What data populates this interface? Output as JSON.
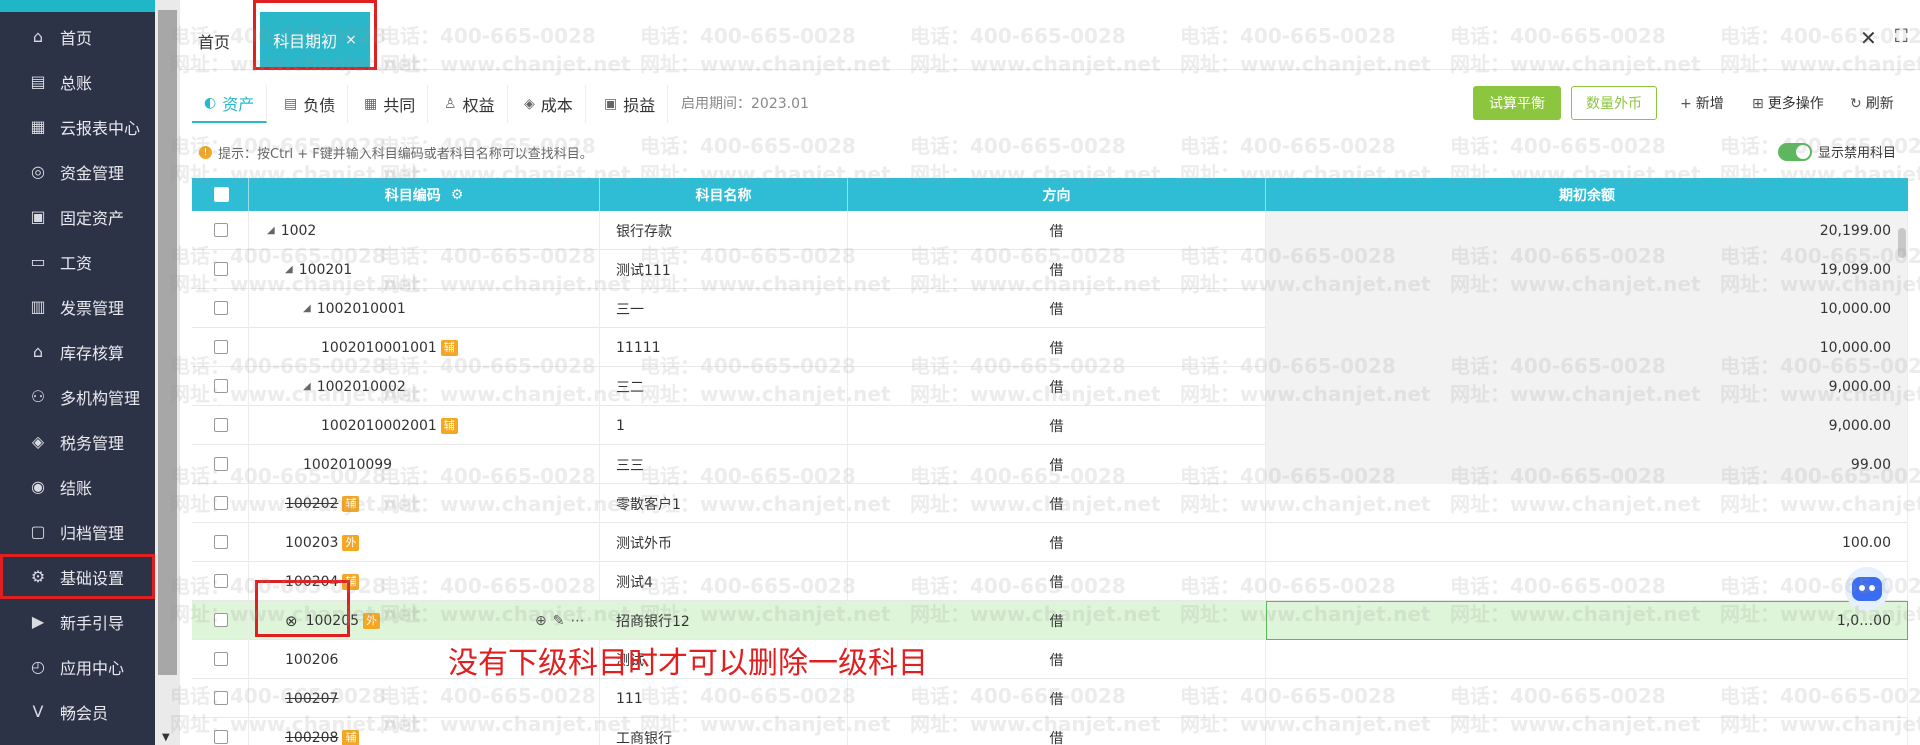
{
  "sidebar": {
    "items": [
      {
        "label": "首页",
        "icon": "home-icon"
      },
      {
        "label": "总账",
        "icon": "ledger-icon"
      },
      {
        "label": "云报表中心",
        "icon": "report-icon"
      },
      {
        "label": "资金管理",
        "icon": "fund-icon"
      },
      {
        "label": "固定资产",
        "icon": "asset-icon"
      },
      {
        "label": "工资",
        "icon": "salary-icon"
      },
      {
        "label": "发票管理",
        "icon": "invoice-icon"
      },
      {
        "label": "库存核算",
        "icon": "inventory-icon"
      },
      {
        "label": "多机构管理",
        "icon": "org-icon"
      },
      {
        "label": "税务管理",
        "icon": "tax-icon"
      },
      {
        "label": "结账",
        "icon": "close-account-icon"
      },
      {
        "label": "归档管理",
        "icon": "archive-icon"
      },
      {
        "label": "基础设置",
        "icon": "gear-icon"
      },
      {
        "label": "新手引导",
        "icon": "guide-icon"
      },
      {
        "label": "应用中心",
        "icon": "app-center-icon"
      },
      {
        "label": "畅会员",
        "icon": "vip-icon"
      }
    ]
  },
  "tabs": {
    "home": "首页",
    "active": "科目期初",
    "close_glyph": "×"
  },
  "categories": [
    {
      "label": "资产",
      "icon": "asset-tab-icon"
    },
    {
      "label": "负债",
      "icon": "liability-tab-icon"
    },
    {
      "label": "共同",
      "icon": "common-tab-icon"
    },
    {
      "label": "权益",
      "icon": "equity-tab-icon"
    },
    {
      "label": "成本",
      "icon": "cost-tab-icon"
    },
    {
      "label": "损益",
      "icon": "profit-loss-tab-icon"
    }
  ],
  "toolbar": {
    "start_date": "启用期间：2023.01",
    "trial_balance": "试算平衡",
    "quantity_fx": "数量外币",
    "add": "新增",
    "more": "更多操作",
    "refresh": "刷新"
  },
  "hint": "提示：按Ctrl + F键并输入科目编码或者科目名称可以查找科目。",
  "toggle_label": "显示禁用科目",
  "table": {
    "headers": {
      "code": "科目编码",
      "name": "科目名称",
      "direction": "方向",
      "balance": "期初余额"
    },
    "rows": [
      {
        "code": "1002",
        "name": "银行存款",
        "direction": "借",
        "balance": "20,199.00",
        "tag": "",
        "strike": false,
        "indent": 0,
        "tri": true
      },
      {
        "code": "100201",
        "name": "测试111",
        "direction": "借",
        "balance": "19,099.00",
        "tag": "",
        "strike": false,
        "indent": 1,
        "tri": true
      },
      {
        "code": "1002010001",
        "name": "三一",
        "direction": "借",
        "balance": "10,000.00",
        "tag": "",
        "strike": false,
        "indent": 2,
        "tri": true
      },
      {
        "code": "1002010001001",
        "name": "11111",
        "direction": "借",
        "balance": "10,000.00",
        "tag": "辅",
        "strike": false,
        "indent": 3,
        "tri": false
      },
      {
        "code": "1002010002",
        "name": "三二",
        "direction": "借",
        "balance": "9,000.00",
        "tag": "",
        "strike": false,
        "indent": 2,
        "tri": true
      },
      {
        "code": "1002010002001",
        "name": "1",
        "direction": "借",
        "balance": "9,000.00",
        "tag": "辅",
        "strike": false,
        "indent": 3,
        "tri": false
      },
      {
        "code": "1002010099",
        "name": "三三",
        "direction": "借",
        "balance": "99.00",
        "tag": "",
        "strike": false,
        "indent": 2,
        "tri": false
      },
      {
        "code": "100202",
        "name": "零散客户1",
        "direction": "借",
        "balance": "",
        "tag": "辅",
        "strike": true,
        "indent": 1,
        "tri": false
      },
      {
        "code": "100203",
        "name": "测试外币",
        "direction": "借",
        "balance": "100.00",
        "tag": "外",
        "strike": false,
        "indent": 1,
        "tri": false
      },
      {
        "code": "100204",
        "name": "测试4",
        "direction": "借",
        "balance": "",
        "tag": "辅",
        "strike": false,
        "indent": 1,
        "tri": false
      },
      {
        "code": "100205",
        "name": "招商银行12",
        "direction": "借",
        "balance": "1,0…00",
        "tag": "外",
        "strike": false,
        "indent": 1,
        "tri": false,
        "highlight": true
      },
      {
        "code": "100206",
        "name": "测试",
        "direction": "借",
        "balance": "",
        "tag": "",
        "strike": false,
        "indent": 1,
        "tri": false
      },
      {
        "code": "100207",
        "name": "111",
        "direction": "借",
        "balance": "",
        "tag": "",
        "strike": true,
        "indent": 1,
        "tri": false
      },
      {
        "code": "100208",
        "name": "工商银行",
        "direction": "借",
        "balance": "",
        "tag": "辅",
        "strike": true,
        "indent": 1,
        "tri": false
      }
    ]
  },
  "annotation": "没有下级科目时才可以删除一级科目",
  "watermark": {
    "phone": "电话：400-665-0028",
    "site": "网址：www.chanjet.net"
  },
  "colors": {
    "sidebar_bg": "#2d3347",
    "accent": "#2ab7c9",
    "header_bg": "#2fbdd6",
    "green": "#8cc63f",
    "highlight_red": "#e02020",
    "tag_orange": "#f5a623"
  }
}
